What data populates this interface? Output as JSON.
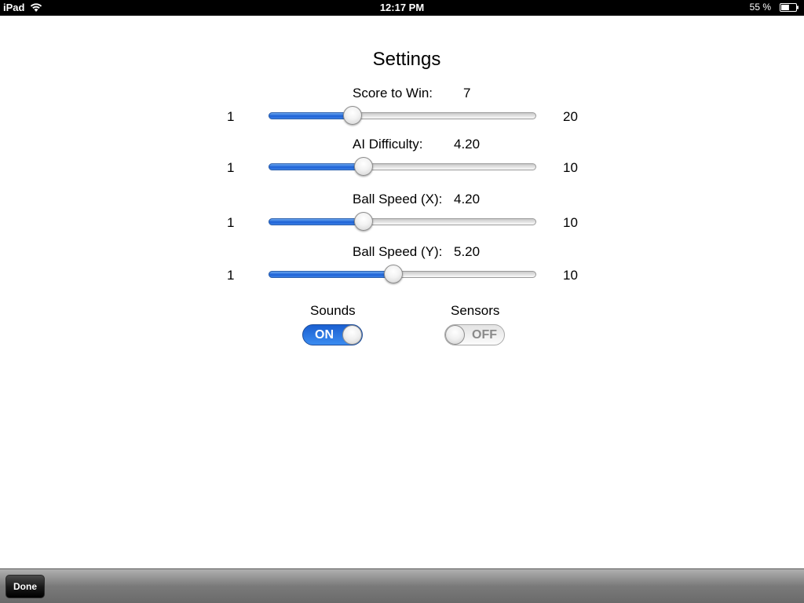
{
  "status_bar": {
    "device": "iPad",
    "time": "12:17 PM",
    "battery": "55 %",
    "battery_level": 0.55,
    "icons": [
      "wifi-icon",
      "battery-icon"
    ]
  },
  "title": "Settings",
  "sliders": [
    {
      "label": "Score to Win:",
      "value": "7",
      "min": "1",
      "max": "20",
      "fraction": 0.315
    },
    {
      "label": "AI Difficulty:",
      "value": "4.20",
      "min": "1",
      "max": "10",
      "fraction": 0.356
    },
    {
      "label": "Ball Speed (X):",
      "value": "4.20",
      "min": "1",
      "max": "10",
      "fraction": 0.356
    },
    {
      "label": "Ball Speed (Y):",
      "value": "5.20",
      "min": "1",
      "max": "10",
      "fraction": 0.467
    }
  ],
  "toggles": [
    {
      "label": "Sounds",
      "state": "ON"
    },
    {
      "label": "Sensors",
      "state": "OFF"
    }
  ],
  "toolbar": {
    "done_label": "Done"
  },
  "colors": {
    "accent": "#2a6fe0",
    "toolbar": "#7a7a7a"
  }
}
